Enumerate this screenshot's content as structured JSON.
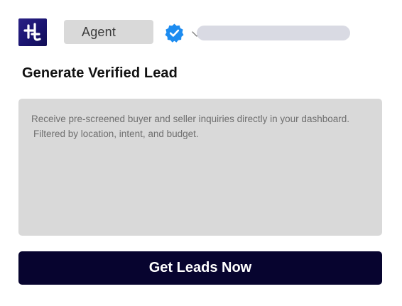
{
  "header": {
    "logo_icon": "brand-logo-icon",
    "role_select": {
      "selected": "Agent",
      "icon": "chevron-down-icon"
    },
    "verified_icon": "verified-badge-icon",
    "verified_color": "#1d8cf0"
  },
  "card": {
    "title": "Generate Verified Lead",
    "description_lines": [
      "Receive pre-screened buyer and seller inquiries directly in your dashboard.",
      "Filtered by location, intent, and budget."
    ]
  },
  "cta": {
    "label": "Get Leads Now",
    "color": "#07042f"
  }
}
